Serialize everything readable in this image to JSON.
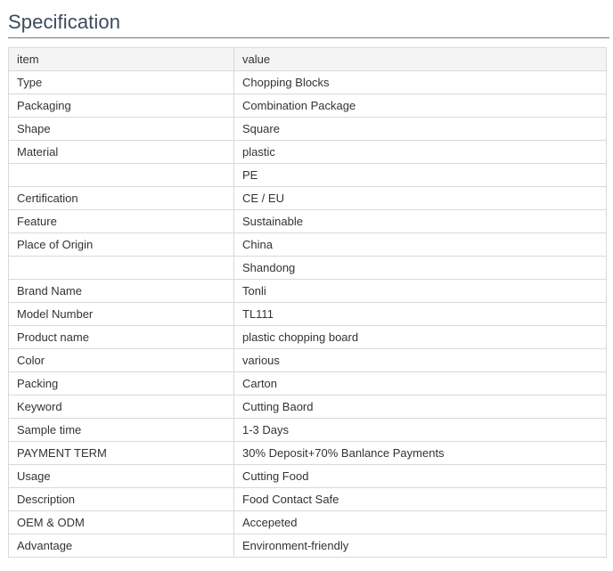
{
  "section": {
    "title": "Specification"
  },
  "table": {
    "header": {
      "item": "item",
      "value": "value"
    },
    "rows": [
      {
        "item": "Type",
        "value": "Chopping Blocks"
      },
      {
        "item": "Packaging",
        "value": "Combination Package"
      },
      {
        "item": "Shape",
        "value": "Square"
      },
      {
        "item": "Material",
        "value": "plastic"
      },
      {
        "item": "",
        "value": "PE"
      },
      {
        "item": "Certification",
        "value": "CE / EU"
      },
      {
        "item": "Feature",
        "value": "Sustainable"
      },
      {
        "item": "Place of Origin",
        "value": "China"
      },
      {
        "item": "",
        "value": "Shandong"
      },
      {
        "item": "Brand Name",
        "value": "Tonli"
      },
      {
        "item": "Model Number",
        "value": "TL111"
      },
      {
        "item": "Product name",
        "value": "plastic chopping board"
      },
      {
        "item": "Color",
        "value": "various"
      },
      {
        "item": "Packing",
        "value": "Carton"
      },
      {
        "item": "Keyword",
        "value": "Cutting Baord"
      },
      {
        "item": "Sample time",
        "value": "1-3 Days"
      },
      {
        "item": "PAYMENT TERM",
        "value": "30% Deposit+70% Banlance Payments"
      },
      {
        "item": "Usage",
        "value": "Cutting Food"
      },
      {
        "item": "Description",
        "value": "Food Contact Safe"
      },
      {
        "item": "OEM & ODM",
        "value": "Accepeted"
      },
      {
        "item": "Advantage",
        "value": "Environment-friendly"
      }
    ]
  }
}
